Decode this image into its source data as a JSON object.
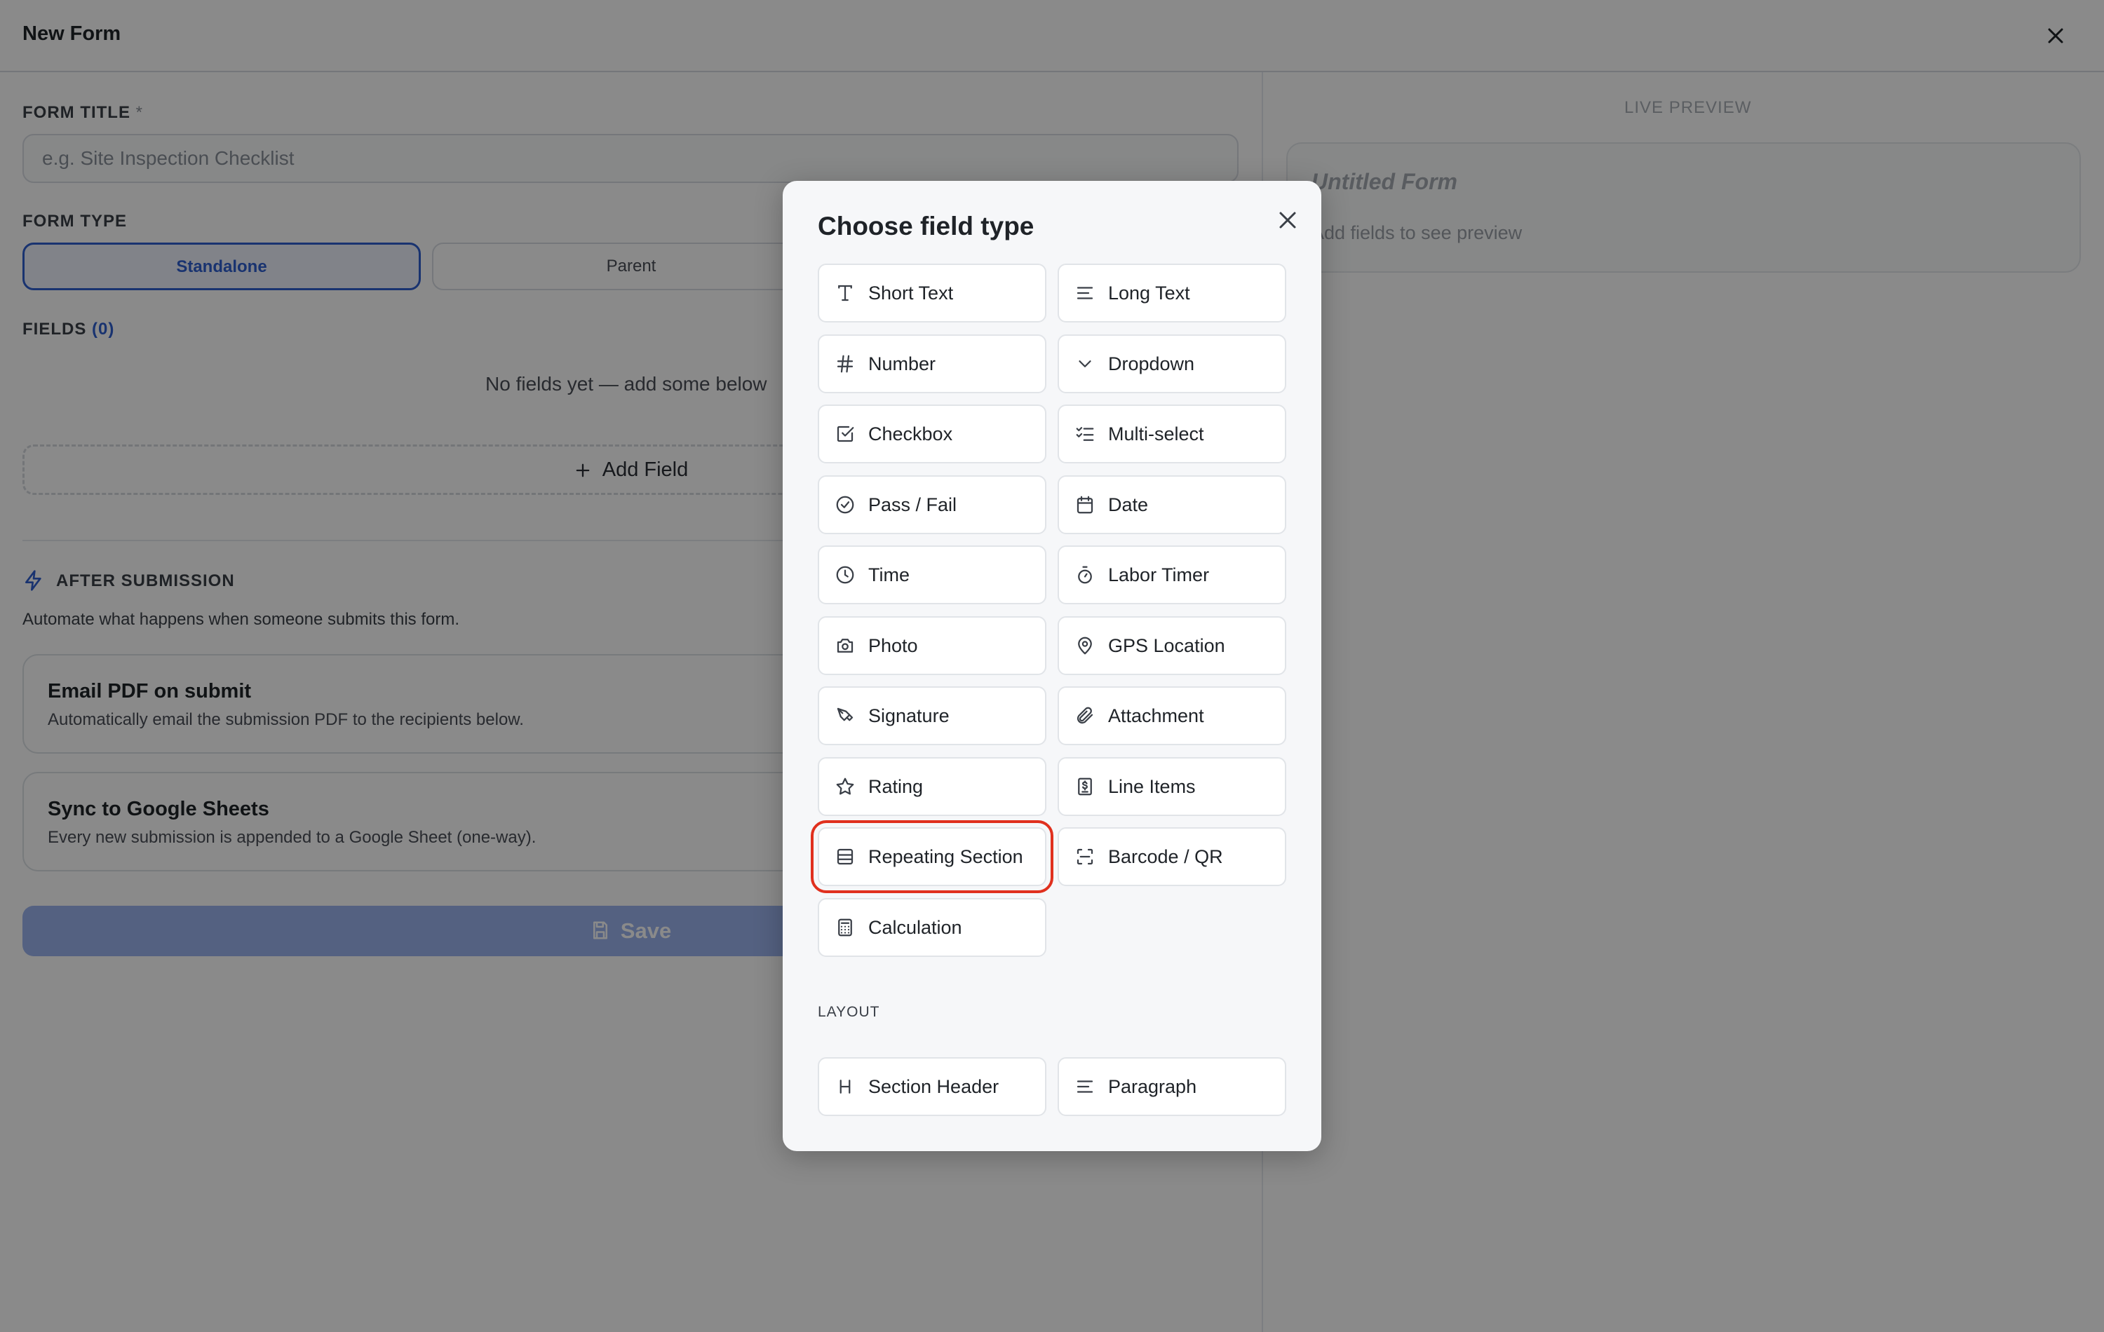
{
  "header": {
    "title": "New Form",
    "close_icon": "close-icon"
  },
  "form": {
    "title_label": "FORM TITLE",
    "required_mark": "*",
    "title_placeholder": "e.g. Site Inspection Checklist",
    "type_label": "FORM TYPE",
    "type_options": [
      "Standalone",
      "Parent"
    ],
    "type_selected": "Standalone",
    "fields_label": "FIELDS",
    "fields_count": "(0)",
    "empty_text": "No fields yet — add some below",
    "add_field_label": "Add Field"
  },
  "after_submission": {
    "title": "AFTER SUBMISSION",
    "description": "Automate what happens when someone submits this form.",
    "cards": [
      {
        "title": "Email PDF on submit",
        "description": "Automatically email the submission PDF to the recipients below."
      },
      {
        "title": "Sync to Google Sheets",
        "description": "Every new submission is appended to a Google Sheet (one-way)."
      }
    ]
  },
  "save_label": "Save",
  "preview": {
    "label": "LIVE PREVIEW",
    "form_title": "Untitled Form",
    "placeholder": "Add fields to see preview"
  },
  "modal": {
    "title": "Choose field type",
    "field_types": [
      {
        "label": "Short Text",
        "icon": "text-t-icon"
      },
      {
        "label": "Long Text",
        "icon": "align-left-icon"
      },
      {
        "label": "Number",
        "icon": "hash-icon"
      },
      {
        "label": "Dropdown",
        "icon": "chevron-down-icon"
      },
      {
        "label": "Checkbox",
        "icon": "checkbox-icon"
      },
      {
        "label": "Multi-select",
        "icon": "list-checks-icon"
      },
      {
        "label": "Pass / Fail",
        "icon": "circle-check-icon"
      },
      {
        "label": "Date",
        "icon": "calendar-icon"
      },
      {
        "label": "Time",
        "icon": "clock-icon"
      },
      {
        "label": "Labor Timer",
        "icon": "stopwatch-icon"
      },
      {
        "label": "Photo",
        "icon": "camera-icon"
      },
      {
        "label": "GPS Location",
        "icon": "map-pin-icon"
      },
      {
        "label": "Signature",
        "icon": "pen-icon"
      },
      {
        "label": "Attachment",
        "icon": "paperclip-icon"
      },
      {
        "label": "Rating",
        "icon": "star-icon"
      },
      {
        "label": "Line Items",
        "icon": "receipt-icon"
      },
      {
        "label": "Repeating Section",
        "icon": "rows-icon",
        "highlighted": true
      },
      {
        "label": "Barcode / QR",
        "icon": "scan-icon"
      },
      {
        "label": "Calculation",
        "icon": "calculator-icon"
      }
    ],
    "layout_label": "LAYOUT",
    "layout_types": [
      {
        "label": "Section Header",
        "icon": "heading-icon"
      },
      {
        "label": "Paragraph",
        "icon": "paragraph-icon"
      }
    ]
  },
  "colors": {
    "accent": "#2f5fcf",
    "highlight": "#e0301e",
    "save_disabled": "#9cb4ef"
  }
}
